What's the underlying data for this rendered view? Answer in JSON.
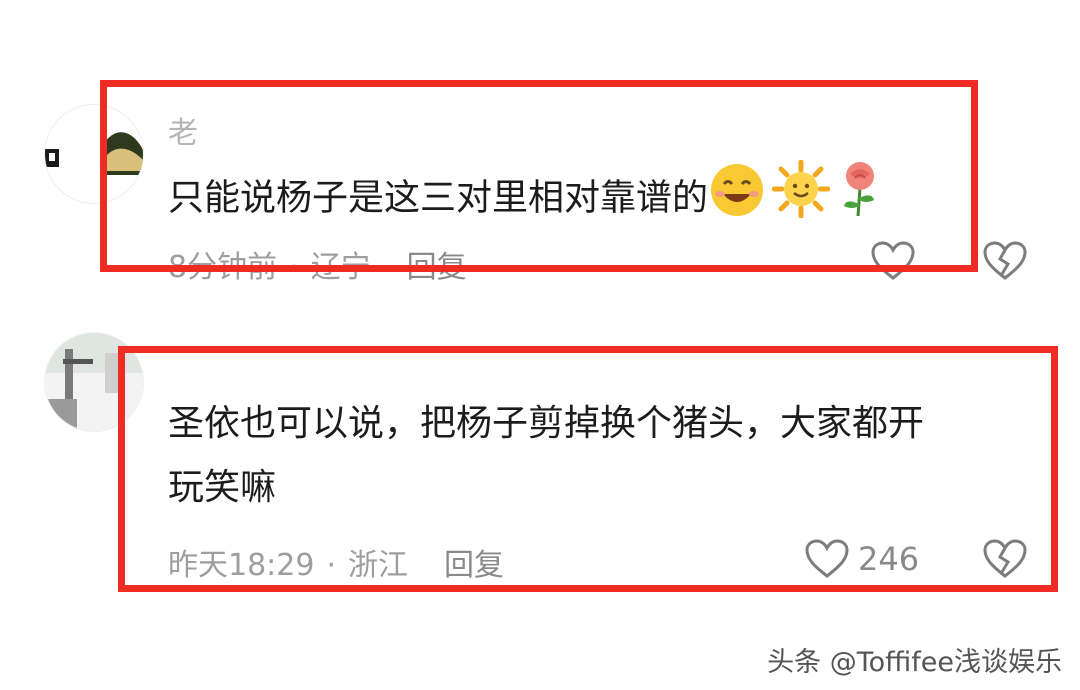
{
  "accent_color": "#ee2c24",
  "comments": [
    {
      "username": "老",
      "text": "只能说杨子是这三对里相对靠谱的",
      "emojis": [
        "grinning-face-icon",
        "sun-with-face-icon",
        "rose-icon"
      ],
      "time": "8分钟前",
      "location": "辽宁",
      "reply_label": "回复",
      "like_icon": "heart-outline-icon",
      "dislike_icon": "broken-heart-icon"
    },
    {
      "username": "",
      "text_line1": "圣依也可以说，把杨子剪掉换个猪头，大家都开",
      "text_line2": "玩笑嘛",
      "time": "昨天18:29",
      "location": "浙江",
      "reply_label": "回复",
      "like_count": "246",
      "like_icon": "heart-outline-icon",
      "dislike_icon": "broken-heart-icon"
    }
  ],
  "separator": "·",
  "watermark": "头条 @Toffifee浅谈娱乐"
}
